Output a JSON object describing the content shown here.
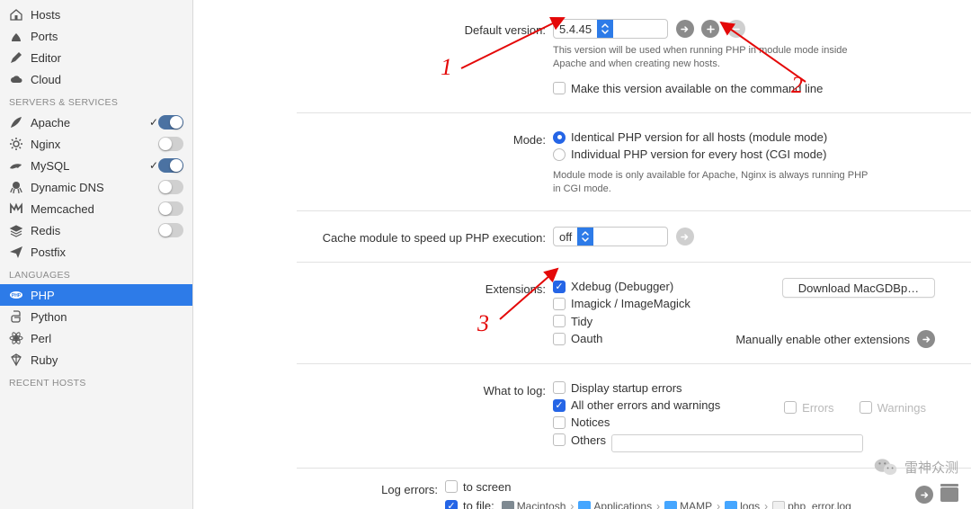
{
  "sidebar": {
    "main_items": [
      {
        "icon": "hosts",
        "label": "Hosts"
      },
      {
        "icon": "ports",
        "label": "Ports"
      },
      {
        "icon": "editor",
        "label": "Editor"
      },
      {
        "icon": "cloud",
        "label": "Cloud"
      }
    ],
    "heading_services": "SERVERS & SERVICES",
    "services": [
      {
        "icon": "feather",
        "label": "Apache",
        "checked": true,
        "toggle": "on"
      },
      {
        "icon": "gear",
        "label": "Nginx",
        "toggle": "off"
      },
      {
        "icon": "dolphin",
        "label": "MySQL",
        "checked": true,
        "toggle": "on"
      },
      {
        "icon": "octo",
        "label": "Dynamic DNS",
        "toggle": "off"
      },
      {
        "icon": "mem",
        "label": "Memcached",
        "toggle": "off"
      },
      {
        "icon": "redis",
        "label": "Redis",
        "toggle": "off"
      },
      {
        "icon": "plane",
        "label": "Postfix"
      }
    ],
    "heading_languages": "LANGUAGES",
    "languages": [
      {
        "icon": "php",
        "label": "PHP",
        "active": true
      },
      {
        "icon": "python",
        "label": "Python"
      },
      {
        "icon": "perl",
        "label": "Perl"
      },
      {
        "icon": "ruby",
        "label": "Ruby"
      }
    ],
    "heading_recent": "RECENT HOSTS"
  },
  "default_version": {
    "label": "Default version:",
    "value": "5.4.45",
    "hint": "This version will be used when running PHP in module mode inside Apache and when creating new hosts.",
    "cmdline_label": "Make this version available on the command line"
  },
  "mode": {
    "label": "Mode:",
    "opt1": "Identical PHP version for all hosts (module mode)",
    "opt2": "Individual PHP version for every host (CGI mode)",
    "hint": "Module mode is only available for Apache, Nginx is always running PHP in CGI mode."
  },
  "cache": {
    "label": "Cache module to speed up PHP execution:",
    "value": "off"
  },
  "extensions": {
    "label": "Extensions:",
    "items": [
      {
        "label": "Xdebug (Debugger)",
        "on": true
      },
      {
        "label": "Imagick / ImageMagick",
        "on": false
      },
      {
        "label": "Tidy",
        "on": false
      },
      {
        "label": "Oauth",
        "on": false
      }
    ],
    "download_btn": "Download MacGDBp…",
    "manual_link": "Manually enable other extensions"
  },
  "whattolog": {
    "label": "What to log:",
    "items": [
      {
        "label": "Display startup errors",
        "on": false
      },
      {
        "label": "All other errors and warnings",
        "on": true
      },
      {
        "label": "Notices",
        "on": false
      },
      {
        "label": "Others",
        "on": false
      }
    ],
    "extra_errors": "Errors",
    "extra_warnings": "Warnings"
  },
  "logerrors": {
    "label": "Log errors:",
    "to_screen": "to screen",
    "to_file": "to file:",
    "path": [
      "Macintosh",
      "Applications",
      "MAMP",
      "logs",
      "php_error.log"
    ]
  },
  "annotations": {
    "n1": "1",
    "n2": "2",
    "n3": "3"
  },
  "watermark": {
    "text": "雷神众测"
  }
}
